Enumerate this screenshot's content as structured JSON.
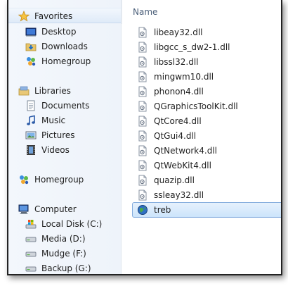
{
  "nav": {
    "favorites": {
      "label": "Favorites",
      "items": [
        {
          "label": "Desktop",
          "icon": "desktop-icon"
        },
        {
          "label": "Downloads",
          "icon": "downloads-folder-icon"
        },
        {
          "label": "Homegroup",
          "icon": "homegroup-icon"
        }
      ]
    },
    "libraries": {
      "label": "Libraries",
      "items": [
        {
          "label": "Documents",
          "icon": "documents-icon"
        },
        {
          "label": "Music",
          "icon": "music-icon"
        },
        {
          "label": "Pictures",
          "icon": "pictures-icon"
        },
        {
          "label": "Videos",
          "icon": "videos-icon"
        }
      ]
    },
    "homegroup": {
      "label": "Homegroup",
      "icon": "homegroup-icon"
    },
    "computer": {
      "label": "Computer",
      "items": [
        {
          "label": "Local Disk (C:)",
          "icon": "system-drive-icon"
        },
        {
          "label": "Media (D:)",
          "icon": "drive-icon"
        },
        {
          "label": "Mudge (F:)",
          "icon": "drive-icon"
        },
        {
          "label": "Backup  (G:)",
          "icon": "drive-icon"
        }
      ]
    }
  },
  "content": {
    "column_header": "Name",
    "files": [
      {
        "name": "libeay32.dll",
        "icon": "dll-file-icon"
      },
      {
        "name": "libgcc_s_dw2-1.dll",
        "icon": "dll-file-icon"
      },
      {
        "name": "libssl32.dll",
        "icon": "dll-file-icon"
      },
      {
        "name": "mingwm10.dll",
        "icon": "dll-file-icon"
      },
      {
        "name": "phonon4.dll",
        "icon": "dll-file-icon"
      },
      {
        "name": "QGraphicsToolKit.dll",
        "icon": "dll-file-icon"
      },
      {
        "name": "QtCore4.dll",
        "icon": "dll-file-icon"
      },
      {
        "name": "QtGui4.dll",
        "icon": "dll-file-icon"
      },
      {
        "name": "QtNetwork4.dll",
        "icon": "dll-file-icon"
      },
      {
        "name": "QtWebKit4.dll",
        "icon": "dll-file-icon"
      },
      {
        "name": "quazip.dll",
        "icon": "dll-file-icon"
      },
      {
        "name": "ssleay32.dll",
        "icon": "dll-file-icon"
      },
      {
        "name": "treb",
        "icon": "app-globe-icon",
        "selected": true
      }
    ]
  },
  "colors": {
    "selection_fill": "#cce4fb",
    "selection_border": "#84acdd",
    "header_text": "#4c607a",
    "nav_background": "#f1f5fb"
  }
}
